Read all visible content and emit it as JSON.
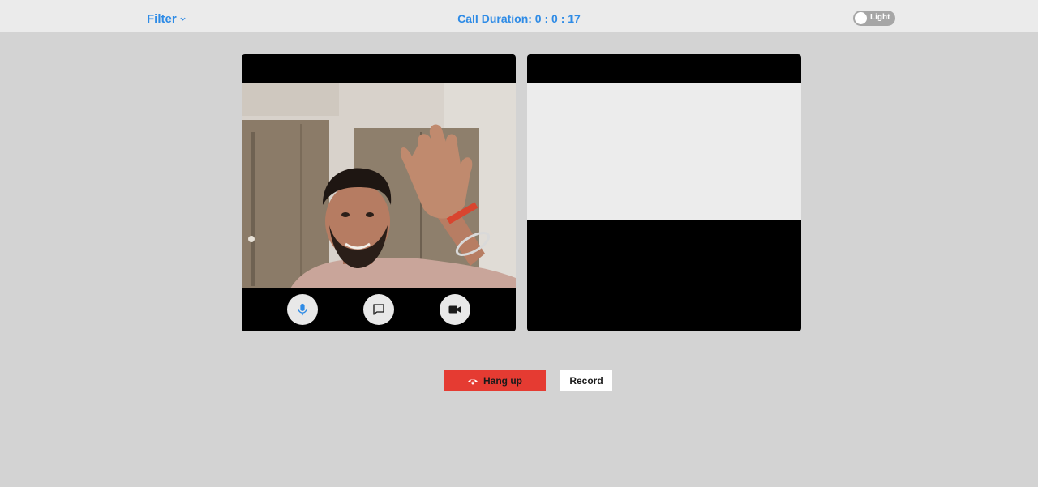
{
  "header": {
    "filter_label": "Filter",
    "call_duration": "Call Duration: 0 : 0 : 17",
    "theme_toggle_label": "Light"
  },
  "local_video": {
    "controls": {
      "mic_icon": "microphone-icon",
      "chat_icon": "chat-icon",
      "camera_icon": "video-camera-icon"
    }
  },
  "actions": {
    "hangup_label": "Hang up",
    "hangup_icon": "phone-hangup-icon",
    "record_label": "Record"
  },
  "colors": {
    "accent": "#2e8be6",
    "hangup": "#e53b32",
    "background": "#d3d3d3",
    "topbar": "#ebebeb"
  }
}
